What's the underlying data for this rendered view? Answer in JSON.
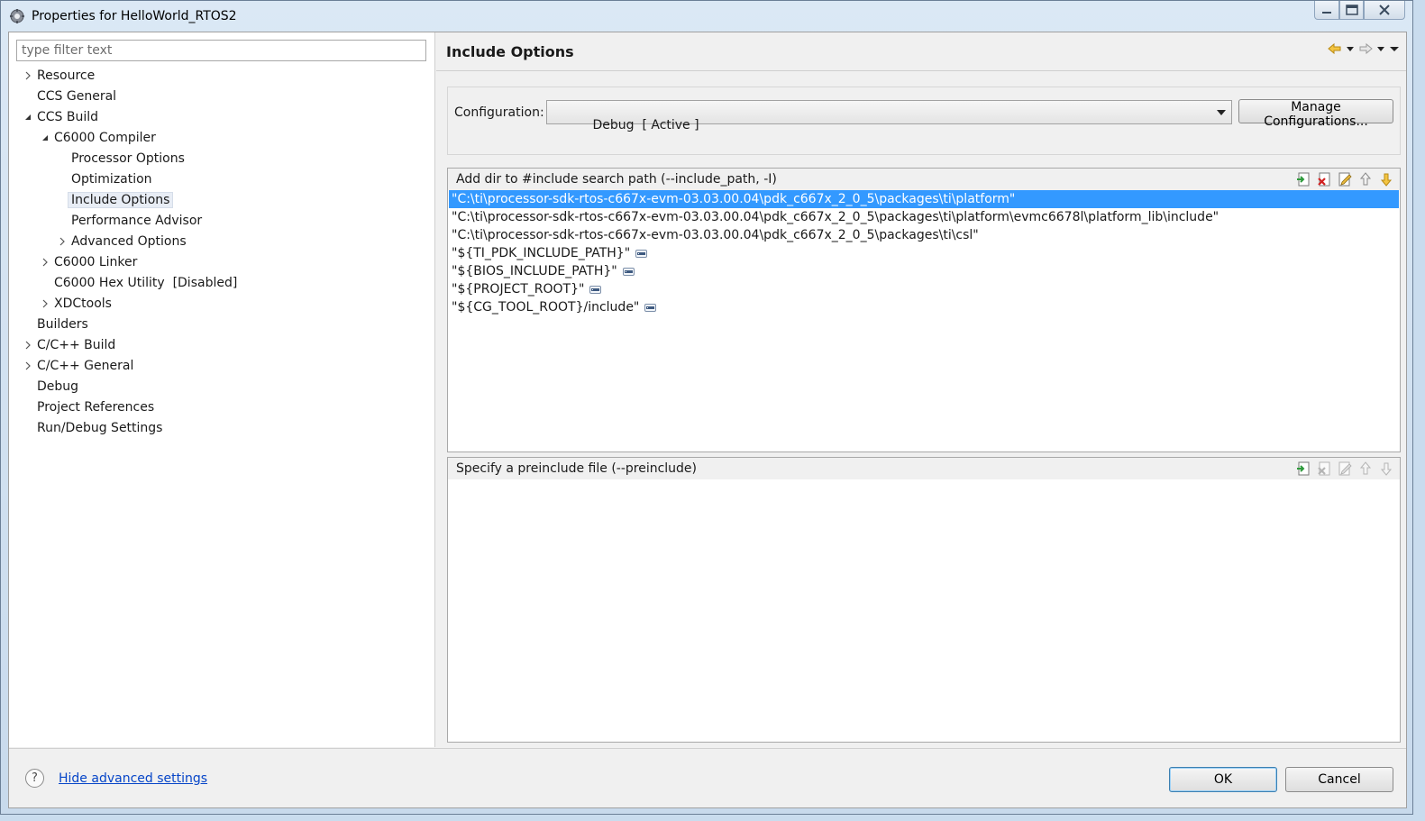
{
  "window": {
    "title": "Properties for HelloWorld_RTOS2"
  },
  "filter": {
    "placeholder": "type filter text",
    "value": ""
  },
  "tree": {
    "items": [
      {
        "label": "Resource",
        "expander": "collapsed"
      },
      {
        "label": "CCS General",
        "expander": "none"
      },
      {
        "label": "CCS Build",
        "expander": "expanded"
      },
      {
        "label": "C6000 Compiler",
        "expander": "expanded"
      },
      {
        "label": "Processor Options",
        "expander": "none"
      },
      {
        "label": "Optimization",
        "expander": "none"
      },
      {
        "label": "Include Options",
        "expander": "none",
        "selected": true
      },
      {
        "label": "Performance Advisor",
        "expander": "none"
      },
      {
        "label": "Advanced Options",
        "expander": "collapsed"
      },
      {
        "label": "C6000 Linker",
        "expander": "collapsed"
      },
      {
        "label": "C6000 Hex Utility  [Disabled]",
        "expander": "none"
      },
      {
        "label": "XDCtools",
        "expander": "collapsed"
      },
      {
        "label": "Builders",
        "expander": "none"
      },
      {
        "label": "C/C++ Build",
        "expander": "collapsed"
      },
      {
        "label": "C/C++ General",
        "expander": "collapsed"
      },
      {
        "label": "Debug",
        "expander": "none"
      },
      {
        "label": "Project References",
        "expander": "none"
      },
      {
        "label": "Run/Debug Settings",
        "expander": "none"
      }
    ]
  },
  "page": {
    "title": "Include Options"
  },
  "config": {
    "label": "Configuration:",
    "selected": "Debug  [ Active ]",
    "manage_label": "Manage Configurations..."
  },
  "include_paths": {
    "title": "Add dir to #include search path (--include_path, -I)",
    "rows": [
      "\"C:\\ti\\processor-sdk-rtos-c667x-evm-03.03.00.04\\pdk_c667x_2_0_5\\packages\\ti\\platform\"",
      "\"C:\\ti\\processor-sdk-rtos-c667x-evm-03.03.00.04\\pdk_c667x_2_0_5\\packages\\ti\\platform\\evmc6678l\\platform_lib\\include\"",
      "\"C:\\ti\\processor-sdk-rtos-c667x-evm-03.03.00.04\\pdk_c667x_2_0_5\\packages\\ti\\csl\"",
      "\"${TI_PDK_INCLUDE_PATH}\"",
      "\"${BIOS_INCLUDE_PATH}\"",
      "\"${PROJECT_ROOT}\"",
      "\"${CG_TOOL_ROOT}/include\""
    ]
  },
  "preinclude": {
    "title": "Specify a preinclude file (--preinclude)"
  },
  "footer": {
    "help_glyph": "?",
    "link_label": "Hide advanced settings",
    "ok_label": "OK",
    "cancel_label": "Cancel"
  },
  "colors": {
    "selection": "#3399ff",
    "link": "#0645c8"
  }
}
